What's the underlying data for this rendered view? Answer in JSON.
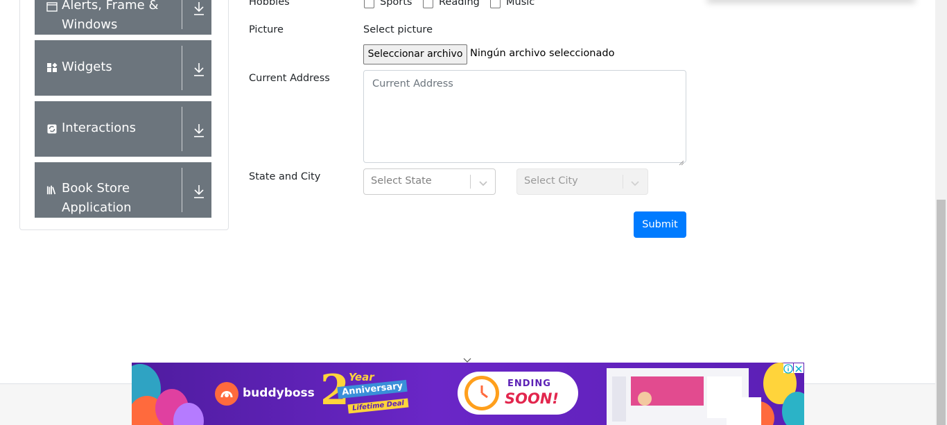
{
  "sidebar": {
    "groups": [
      {
        "label_line1": "Alerts, Frame &",
        "label_line2": "Windows",
        "icon": "window-icon"
      },
      {
        "label": "Widgets",
        "icon": "widgets-icon"
      },
      {
        "label": "Interactions",
        "icon": "interactions-icon"
      },
      {
        "label_line1": "Book Store",
        "label_line2": "Application",
        "icon": "books-icon"
      }
    ]
  },
  "form": {
    "hobbies": {
      "label": "Hobbies",
      "options": [
        "Sports",
        "Reading",
        "Music"
      ]
    },
    "picture": {
      "label": "Picture",
      "select_text": "Select picture",
      "button_label": "Seleccionar archivo",
      "status": "Ningún archivo seleccionado"
    },
    "address": {
      "label": "Current Address",
      "placeholder": "Current Address"
    },
    "state_city": {
      "label": "State and City",
      "state_placeholder": "Select State",
      "city_placeholder": "Select City"
    },
    "submit_label": "Submit"
  },
  "ad": {
    "brand": "buddyboss",
    "badge_number": "2",
    "badge_year": "Year",
    "badge_anniversary": "Anniversary",
    "badge_deal": "Lifetime Deal",
    "ending": "ENDING",
    "soon": "SOON!"
  },
  "colors": {
    "sidebar_group": "#6c757d",
    "submit": "#007bff",
    "ad_background": "#5b1fb5"
  }
}
